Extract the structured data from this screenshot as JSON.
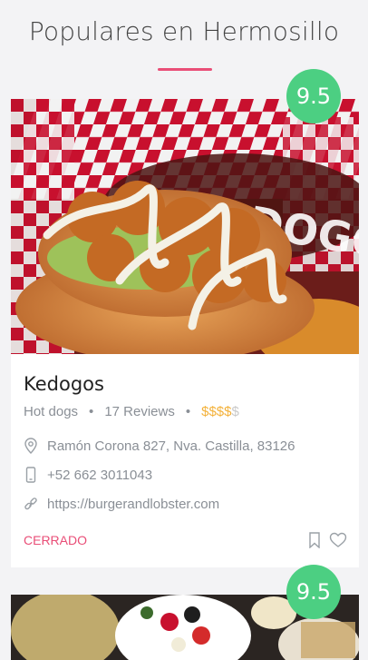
{
  "section": {
    "title": "Populares en Hermosillo"
  },
  "cards": [
    {
      "rating": "9.5",
      "name": "Kedogos",
      "category": "Hot dogs",
      "reviews": "17 Reviews",
      "price_on": "$$$$",
      "price_off": "$",
      "address": "Ramón Corona 827, Nva. Castilla, 83126",
      "phone": "+52 662 3011043",
      "website": "https://burgerandlobster.com",
      "status": "CERRADO",
      "image": "hot dog photo",
      "icons": [
        "location-pin-icon",
        "phone-icon",
        "link-icon",
        "bookmark-icon",
        "heart-icon"
      ]
    },
    {
      "rating": "9.5",
      "image": "restaurant table photo"
    }
  ],
  "colors": {
    "accent": "#e94e77",
    "rating_badge": "#4ccf82",
    "price_active": "#f3b13a",
    "muted_text": "#8a8f96",
    "background": "#f3f3f5"
  }
}
